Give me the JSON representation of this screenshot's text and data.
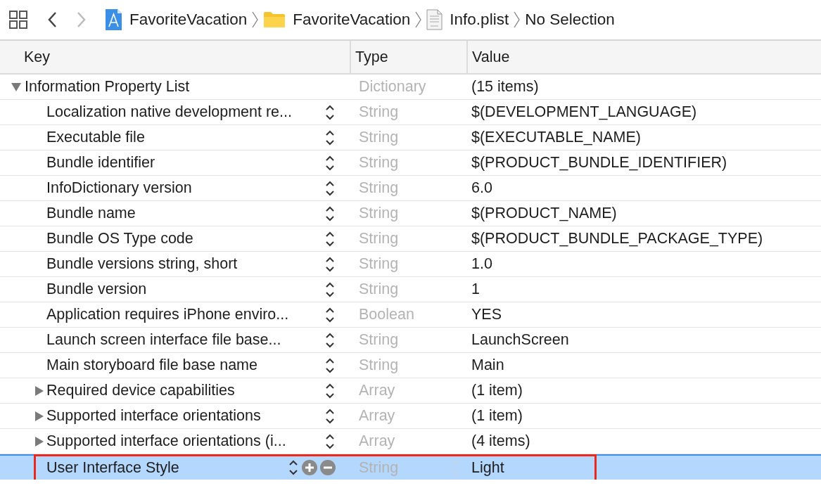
{
  "toolbar": {
    "back_enabled": true,
    "forward_enabled": false,
    "breadcrumbs": [
      {
        "label": "FavoriteVacation",
        "kind": "project"
      },
      {
        "label": "FavoriteVacation",
        "kind": "folder"
      },
      {
        "label": "Info.plist",
        "kind": "plist"
      },
      {
        "label": "No Selection",
        "kind": "none"
      }
    ]
  },
  "columns": [
    "Key",
    "Type",
    "Value"
  ],
  "root": {
    "key": "Information Property List",
    "type": "Dictionary",
    "value": "(15 items)",
    "expanded": true,
    "children": [
      {
        "key": "Localization native development re...",
        "type": "String",
        "value": "$(DEVELOPMENT_LANGUAGE)",
        "selected": false,
        "highlighted": false
      },
      {
        "key": "Executable file",
        "type": "String",
        "value": "$(EXECUTABLE_NAME)",
        "selected": false,
        "highlighted": false
      },
      {
        "key": "Bundle identifier",
        "type": "String",
        "value": "$(PRODUCT_BUNDLE_IDENTIFIER)",
        "selected": false,
        "highlighted": false
      },
      {
        "key": "InfoDictionary version",
        "type": "String",
        "value": "6.0",
        "selected": false,
        "highlighted": false
      },
      {
        "key": "Bundle name",
        "type": "String",
        "value": "$(PRODUCT_NAME)",
        "selected": false,
        "highlighted": false
      },
      {
        "key": "Bundle OS Type code",
        "type": "String",
        "value": "$(PRODUCT_BUNDLE_PACKAGE_TYPE)",
        "selected": false,
        "highlighted": false
      },
      {
        "key": "Bundle versions string, short",
        "type": "String",
        "value": "1.0",
        "selected": false,
        "highlighted": false
      },
      {
        "key": "Bundle version",
        "type": "String",
        "value": "1",
        "selected": false,
        "highlighted": false
      },
      {
        "key": "Application requires iPhone enviro...",
        "type": "Boolean",
        "value": "YES",
        "selected": false,
        "highlighted": false
      },
      {
        "key": "Launch screen interface file base...",
        "type": "String",
        "value": "LaunchScreen",
        "selected": false,
        "highlighted": false
      },
      {
        "key": "Main storyboard file base name",
        "type": "String",
        "value": "Main",
        "selected": false,
        "highlighted": false
      },
      {
        "key": "Required device capabilities",
        "type": "Array",
        "value": "(1 item)",
        "expanded": false,
        "selected": false,
        "highlighted": false
      },
      {
        "key": "Supported interface orientations",
        "type": "Array",
        "value": "(1 item)",
        "expanded": false,
        "selected": false,
        "highlighted": false
      },
      {
        "key": "Supported interface orientations (i...",
        "type": "Array",
        "value": "(4 items)",
        "expanded": false,
        "selected": false,
        "highlighted": false
      },
      {
        "key": "User Interface Style",
        "type": "String",
        "value": "Light",
        "selected": true,
        "highlighted": true
      }
    ]
  }
}
